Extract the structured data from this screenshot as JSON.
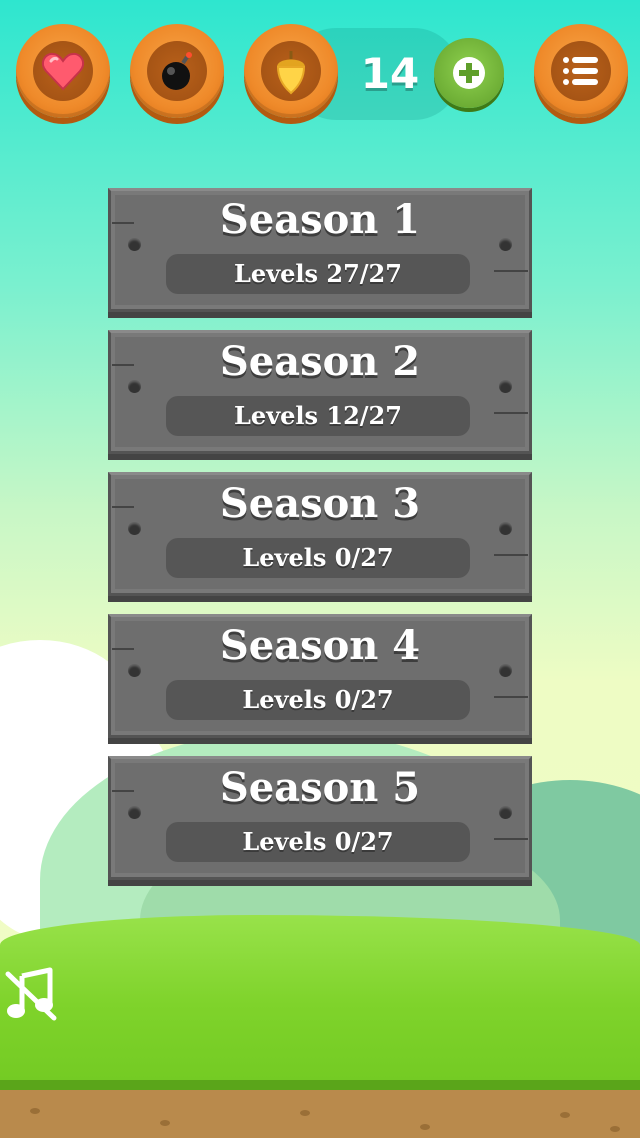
{
  "hud": {
    "heart_icon": "heart-icon",
    "bomb_icon": "bomb-icon",
    "acorn_icon": "acorn-icon",
    "coin_count": "14",
    "add_icon": "plus-icon",
    "menu_icon": "list-icon"
  },
  "seasons": [
    {
      "title": "Season 1",
      "progress": "Levels 27/27"
    },
    {
      "title": "Season 2",
      "progress": "Levels 12/27"
    },
    {
      "title": "Season 3",
      "progress": "Levels 0/27"
    },
    {
      "title": "Season 4",
      "progress": "Levels 0/27"
    },
    {
      "title": "Season 5",
      "progress": "Levels 0/27"
    }
  ],
  "footer": {
    "music_icon": "music-muted-icon"
  },
  "colors": {
    "hud_orange": "#ef8a2a",
    "add_green": "#5f9f2a",
    "panel_gray": "#6e6e6e"
  }
}
